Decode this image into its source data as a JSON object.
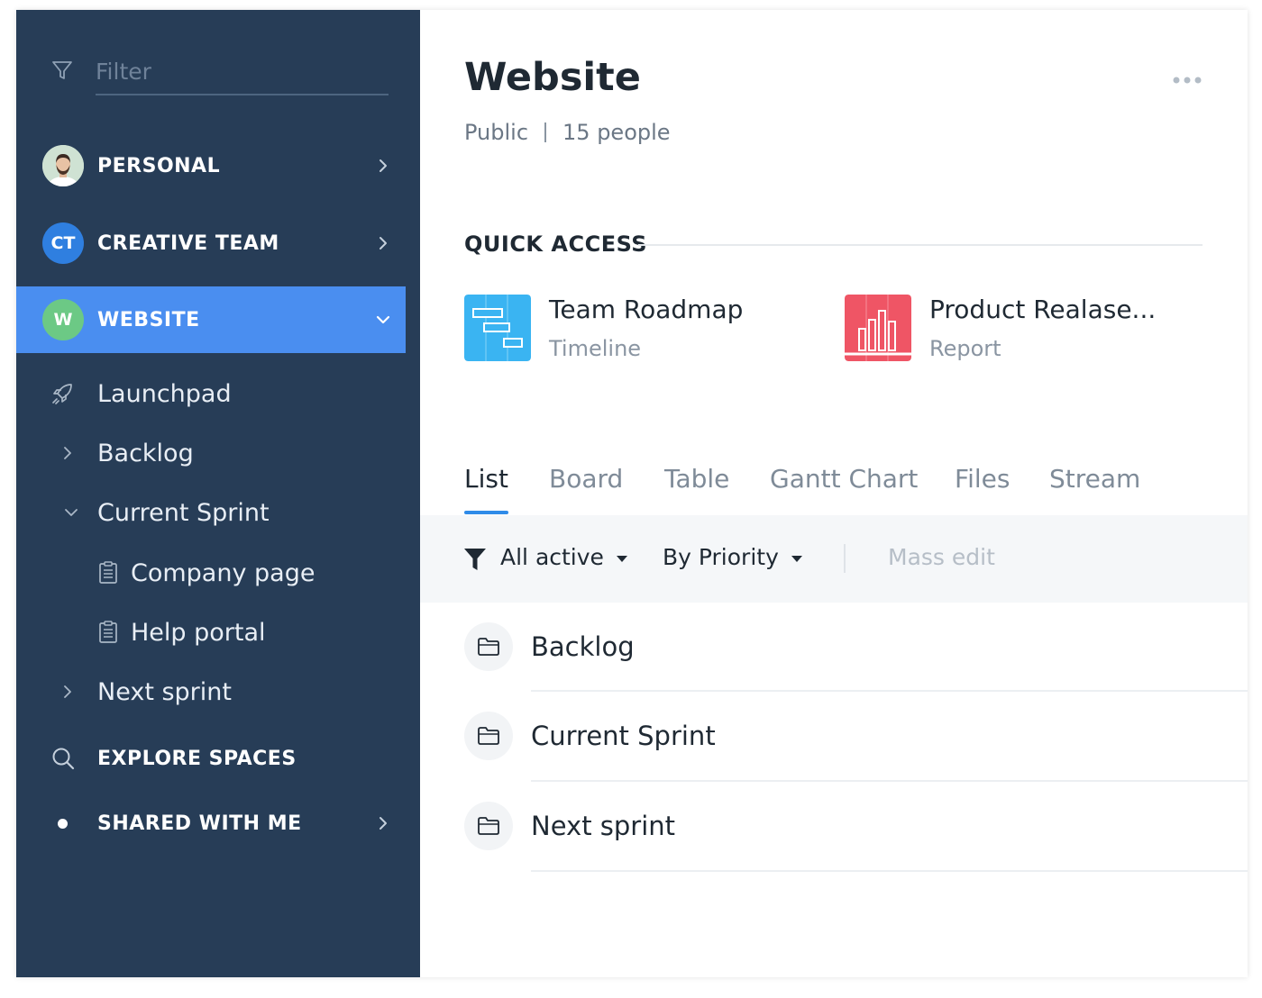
{
  "sidebar": {
    "filter_placeholder": "Filter",
    "spaces": [
      {
        "label": "PERSONAL",
        "avatar": "photo",
        "avatar_bg": "#d0e3d5"
      },
      {
        "label": "CREATIVE TEAM",
        "avatar_text": "CT",
        "avatar_bg": "#2f7fe0"
      },
      {
        "label": "WEBSITE",
        "avatar_text": "W",
        "avatar_bg": "#6cc985",
        "active": true
      }
    ],
    "tree": {
      "launchpad": "Launchpad",
      "backlog": "Backlog",
      "current_sprint": "Current Sprint",
      "company_page": "Company page",
      "help_portal": "Help portal",
      "next_sprint": "Next sprint"
    },
    "explore": "EXPLORE SPACES",
    "shared": "SHARED WITH ME"
  },
  "main": {
    "title": "Website",
    "visibility": "Public",
    "people": "15 people",
    "quick_access_title": "QUICK ACCESS",
    "quick_access": [
      {
        "name": "Team Roadmap",
        "type": "Timeline",
        "color": "#3ab4f2"
      },
      {
        "name": "Product Realase...",
        "type": "Report",
        "color": "#ef5565"
      }
    ],
    "tabs": [
      "List",
      "Board",
      "Table",
      "Gantt Chart",
      "Files",
      "Stream"
    ],
    "toolbar": {
      "filter": "All active",
      "sort": "By Priority",
      "mass_edit": "Mass edit"
    },
    "folders": [
      "Backlog",
      "Current Sprint",
      "Next sprint"
    ]
  },
  "colors": {
    "sidebar_bg": "#273d57",
    "active_bg": "#4a8ef0",
    "accent": "#2f8be8"
  }
}
